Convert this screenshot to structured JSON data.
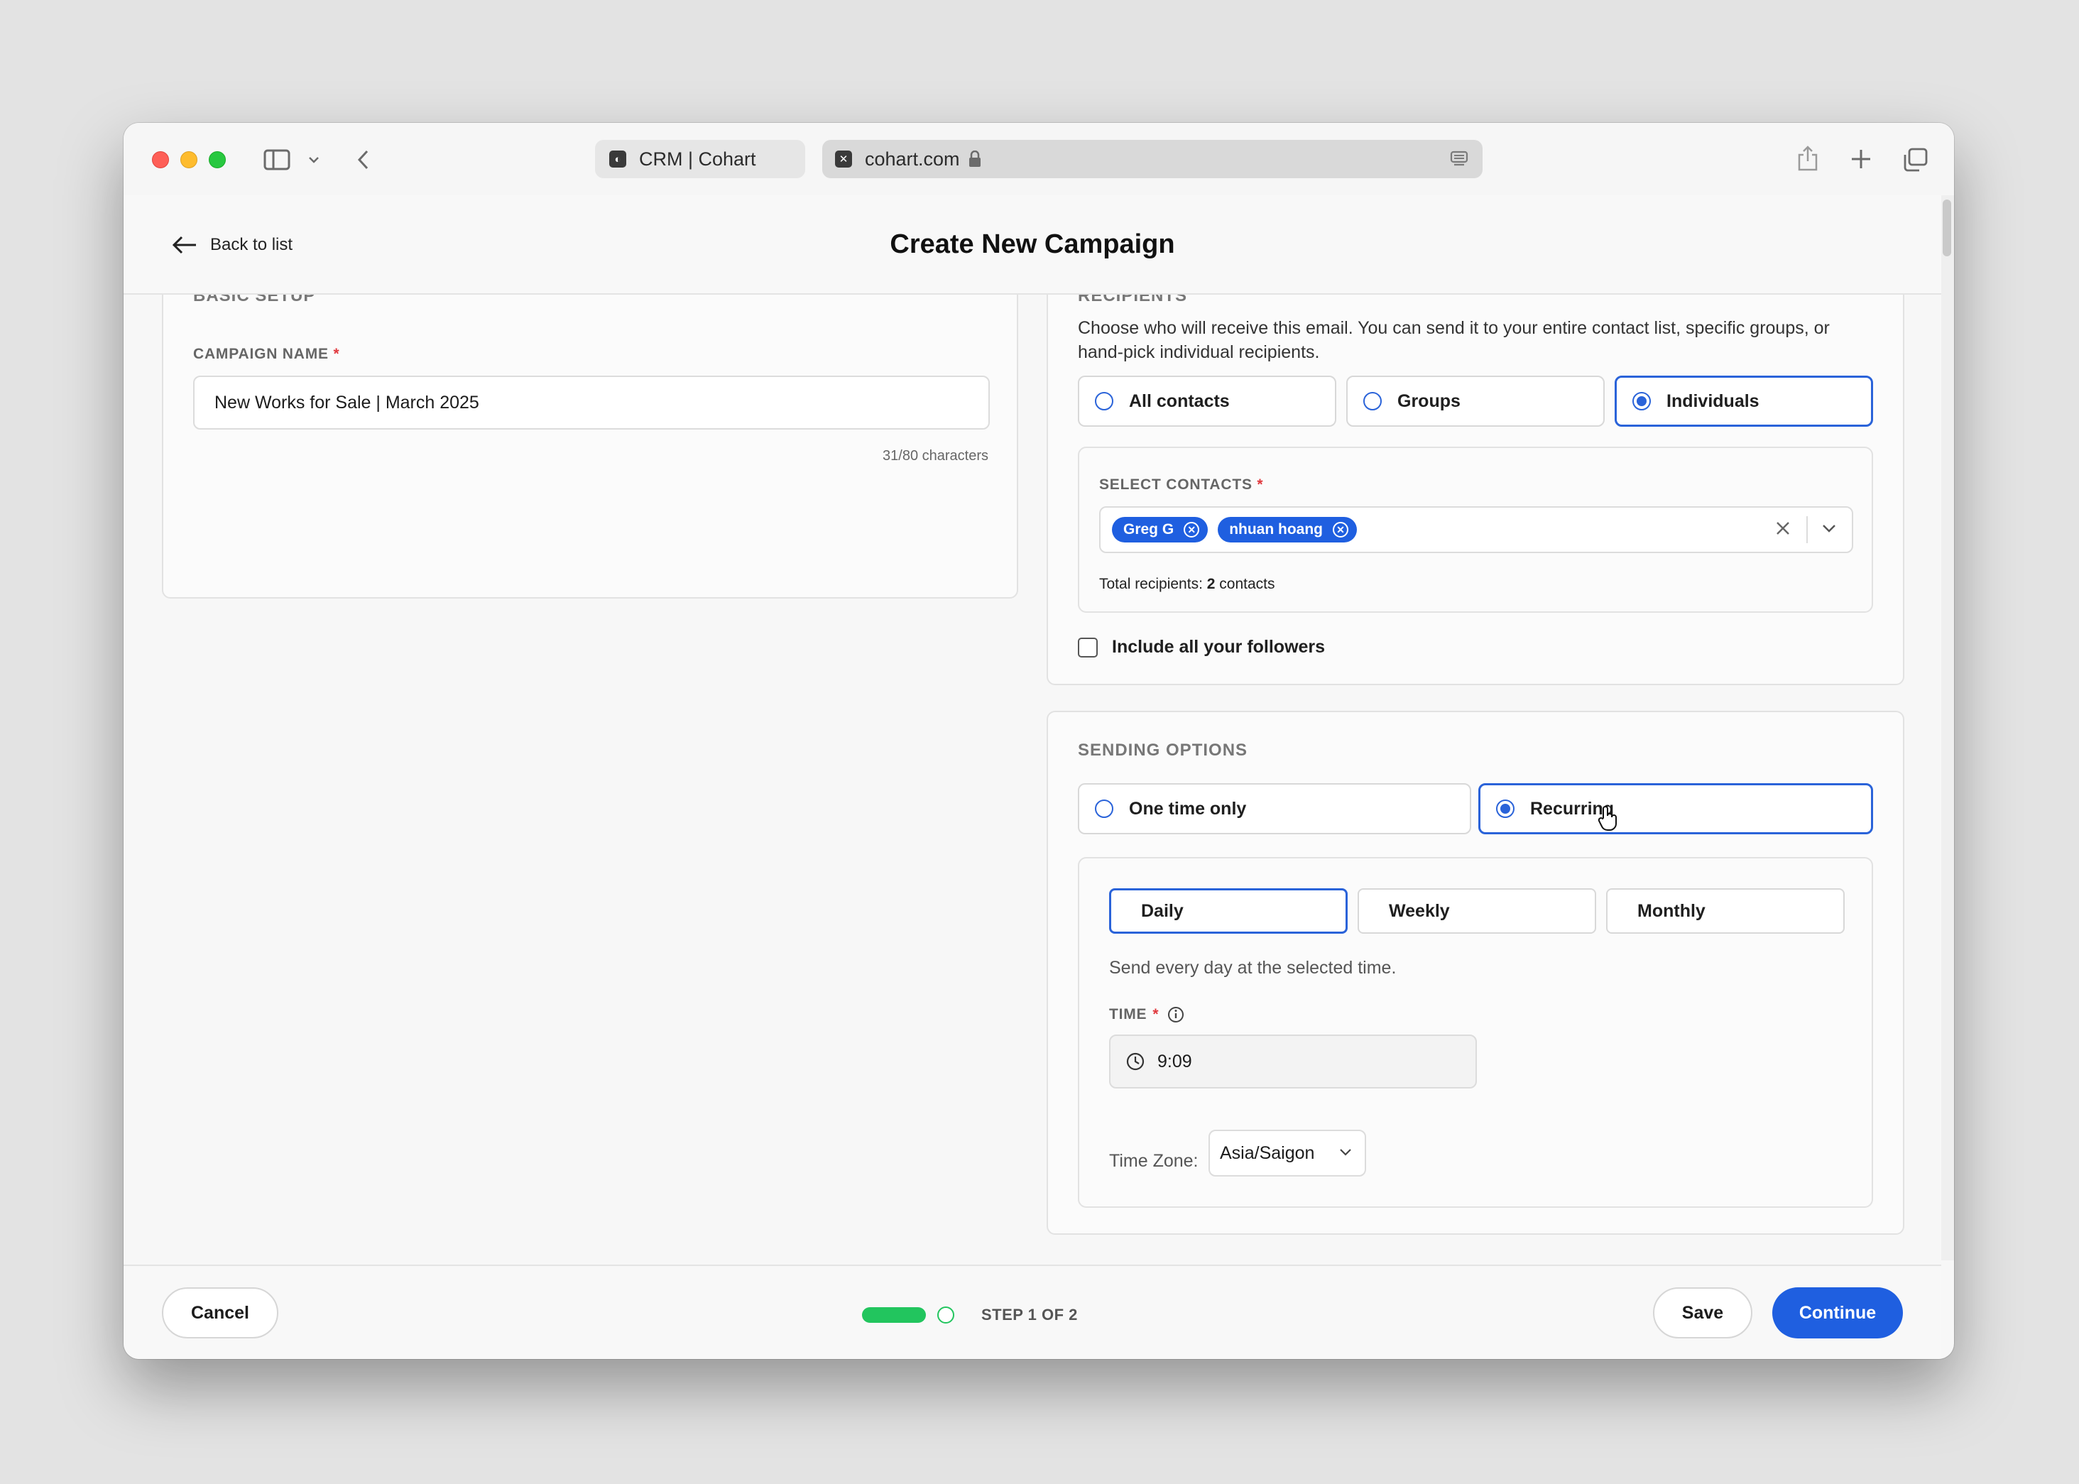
{
  "browser": {
    "tab_inactive": "CRM | Cohart",
    "url": "cohart.com"
  },
  "header": {
    "back_label": "Back to list",
    "title": "Create New Campaign"
  },
  "basic_setup": {
    "section_label": "BASIC SETUP",
    "campaign_name_label": "CAMPAIGN NAME",
    "required_mark": "*",
    "campaign_name_value": "New Works for Sale | March 2025",
    "char_count": "31/80 characters"
  },
  "recipients": {
    "section_label": "RECIPIENTS",
    "description": "Choose who will receive this email. You can send it to your entire contact list, specific groups, or hand-pick individual recipients.",
    "options": [
      "All contacts",
      "Groups",
      "Individuals"
    ],
    "selected": "Individuals",
    "select_contacts_label": "SELECT CONTACTS",
    "required_mark": "*",
    "chips": [
      "Greg G",
      "nhuan hoang"
    ],
    "total_prefix": "Total recipients: ",
    "total_count": "2",
    "total_suffix": " contacts",
    "followers_label": "Include all your followers",
    "followers_checked": false
  },
  "sending": {
    "section_label": "SENDING OPTIONS",
    "options": [
      "One time only",
      "Recurring"
    ],
    "selected": "Recurring",
    "frequencies": [
      "Daily",
      "Weekly",
      "Monthly"
    ],
    "selected_frequency": "Daily",
    "frequency_hint": "Send every day at the selected time.",
    "time_label": "TIME",
    "required_mark": "*",
    "time_value": "9:09",
    "timezone_label": "Time Zone:",
    "timezone_value": "Asia/Saigon"
  },
  "footer": {
    "cancel_label": "Cancel",
    "step_label": "STEP 1 OF 2",
    "save_label": "Save",
    "continue_label": "Continue"
  },
  "colors": {
    "accent": "#1f5fe0",
    "required": "#e0393e",
    "progress": "#22c55e"
  }
}
